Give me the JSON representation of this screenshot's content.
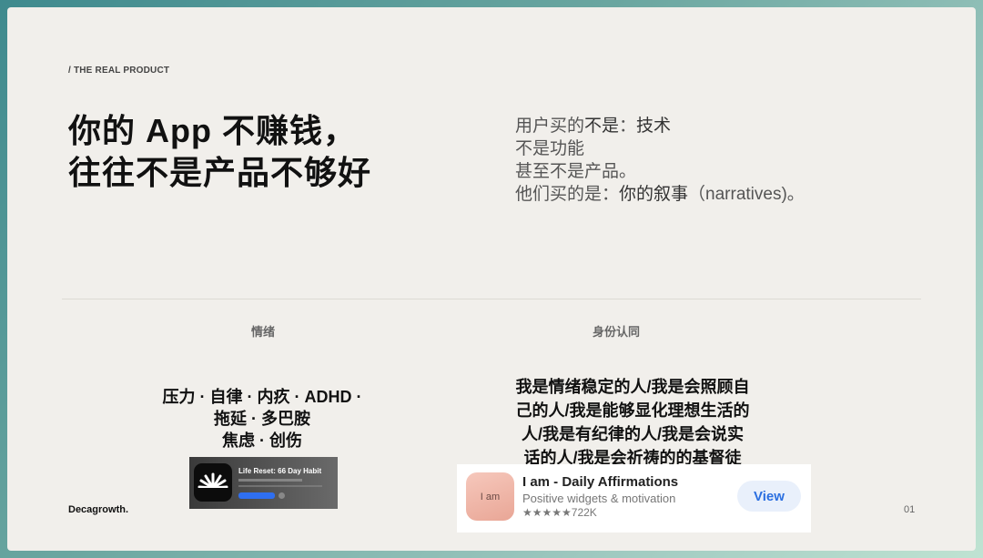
{
  "kicker": "/ THE REAL PRODUCT",
  "headline": {
    "line1": "你的 App 不赚钱，",
    "line2": "往往不是产品不够好"
  },
  "side_note": {
    "l1_a": "用户买的",
    "l1_b": "不是",
    "l1_c": "：",
    "l1_d": "技术",
    "l2": "不是功能",
    "l3": "甚至不是产品。",
    "l4_a": "他们买的是：",
    "l4_b": "你的叙事",
    "l4_c": "（narratives)。"
  },
  "columns": {
    "emotion": {
      "label": "情绪",
      "tags_line1": "压力 · 自律 · 内疚 · ADHD ·",
      "tags_line2": "拖延 · 多巴胺",
      "tags_line3": "焦虑 · 创伤"
    },
    "identity": {
      "label": "身份认同",
      "line1": "我是情绪稳定的人/我是会照顾自",
      "line2": "己的人/我是能够显化理想生活的",
      "line3": "人/我是有纪律的人/我是会说实",
      "line4": "话的人/我是会祈祷的的基督徒"
    }
  },
  "habit_app": {
    "title": "Life Reset: 66 Day Habit",
    "icon": "sunrise-icon"
  },
  "app_card": {
    "icon_text": "I am",
    "name": "I am - Daily Affirmations",
    "subtitle": "Positive widgets & motivation",
    "rating": "★★★★★722K",
    "button": "View",
    "accent": "#2b6fe0"
  },
  "footer": {
    "brand": "Decagrowth.",
    "page": "01"
  }
}
